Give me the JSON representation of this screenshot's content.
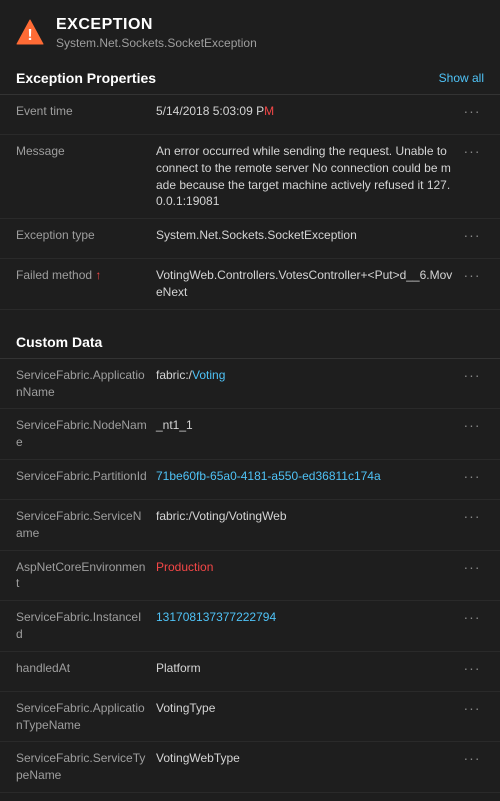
{
  "header": {
    "title": "EXCEPTION",
    "subtitle": "System.Net.Sockets.SocketException"
  },
  "exception_properties": {
    "section_title": "Exception Properties",
    "show_all_label": "Show all",
    "rows": [
      {
        "key": "Event time",
        "value": "5/14/2018 5:03:09 P",
        "value_highlight": "M",
        "highlight_suffix": true
      },
      {
        "key": "Message",
        "value": "An error occurred while sending the request. Unable to connect to the remote server No connection could be made because the target machine actively refused it 127.0.0.1:19081",
        "value_highlight": null
      },
      {
        "key": "Exception type",
        "value": "System.Net.Sockets.SocketException",
        "value_highlight": null
      },
      {
        "key": "Failed method",
        "value": "VotingWeb.Controllers.VotesController+<Put>d__6.MoveNext",
        "value_highlight": null
      }
    ]
  },
  "custom_data": {
    "section_title": "Custom Data",
    "rows": [
      {
        "key": "ServiceFabric.ApplicationName",
        "value": "fabric:/Voting",
        "blue_part": "Voting"
      },
      {
        "key": "ServiceFabric.NodeName",
        "value": "_nt1_1",
        "blue_part": null
      },
      {
        "key": "ServiceFabric.PartitionId",
        "value": "71be60fb-65a0-4181-a550-ed36811c174a",
        "blue_part": "71be60fb-65a0-4181-a550-ed36811c174a"
      },
      {
        "key": "ServiceFabric.ServiceName",
        "value": "fabric:/Voting/VotingWeb",
        "blue_part": null
      },
      {
        "key": "AspNetCoreEnvironment",
        "value": "Production",
        "red_part": "Production"
      },
      {
        "key": "ServiceFabric.InstanceId",
        "value": "131708137377222794",
        "blue_part": "131708137377222794"
      },
      {
        "key": "handledAt",
        "value": "Platform",
        "blue_part": null
      },
      {
        "key": "ServiceFabric.ApplicationTypeName",
        "value": "VotingType",
        "blue_part": null
      },
      {
        "key": "ServiceFabric.ServiceTypeName",
        "value": "VotingWebType",
        "blue_part": null
      }
    ]
  }
}
